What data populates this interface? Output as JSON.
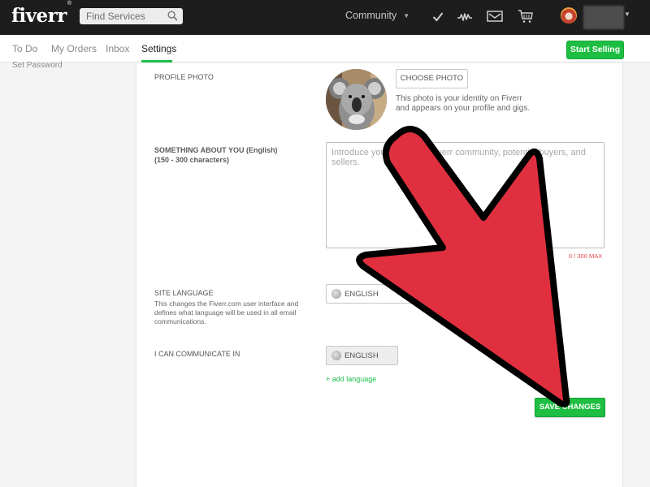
{
  "header": {
    "logo": "fiverr",
    "logo_mark": "®",
    "search": {
      "placeholder": "Find Services",
      "icon": "search-icon"
    },
    "community_label": "Community",
    "icons": [
      "check-icon",
      "activity-icon",
      "mail-icon",
      "cart-icon"
    ],
    "user_menu_caret": "▼"
  },
  "subnav": {
    "tabs": [
      {
        "label": "To Do",
        "active": false
      },
      {
        "label": "My Orders",
        "active": false
      },
      {
        "label": "Inbox",
        "active": false
      },
      {
        "label": "Settings",
        "active": true
      }
    ],
    "start_selling_label": "Start Selling"
  },
  "sidebar": {
    "items": [
      {
        "label": "Set Password"
      }
    ]
  },
  "settings": {
    "profile_photo": {
      "label": "PROFILE PHOTO",
      "button": "CHOOSE PHOTO",
      "help_line1": "This photo is your identity on Fiverr",
      "help_line2": "and appears on your profile and gigs."
    },
    "about": {
      "label_line1": "SOMETHING ABOUT YOU (English)",
      "label_line2": "(150 - 300 characters)",
      "placeholder": "Introduce yourself to the Fiverr community, potential buyers, and sellers.",
      "value": "",
      "counter": "0 / 300 MAX"
    },
    "site_language": {
      "label": "SITE LANGUAGE",
      "description": "This changes the Fiverr.com user interface and defines what language will be used in all email communications.",
      "selected": "ENGLISH"
    },
    "communicate": {
      "label": "I CAN COMMUNICATE IN",
      "languages": [
        "ENGLISH"
      ],
      "add_label": "+ add language"
    },
    "save_label": "SAVE CHANGES"
  },
  "overlay": {
    "annotation": "red-arrow-pointing-to-save-changes",
    "color": "#e0303f"
  },
  "colors": {
    "brand_green": "#1dbf49",
    "header_bg": "#1d1d1d",
    "error_red": "#e54b4b"
  }
}
